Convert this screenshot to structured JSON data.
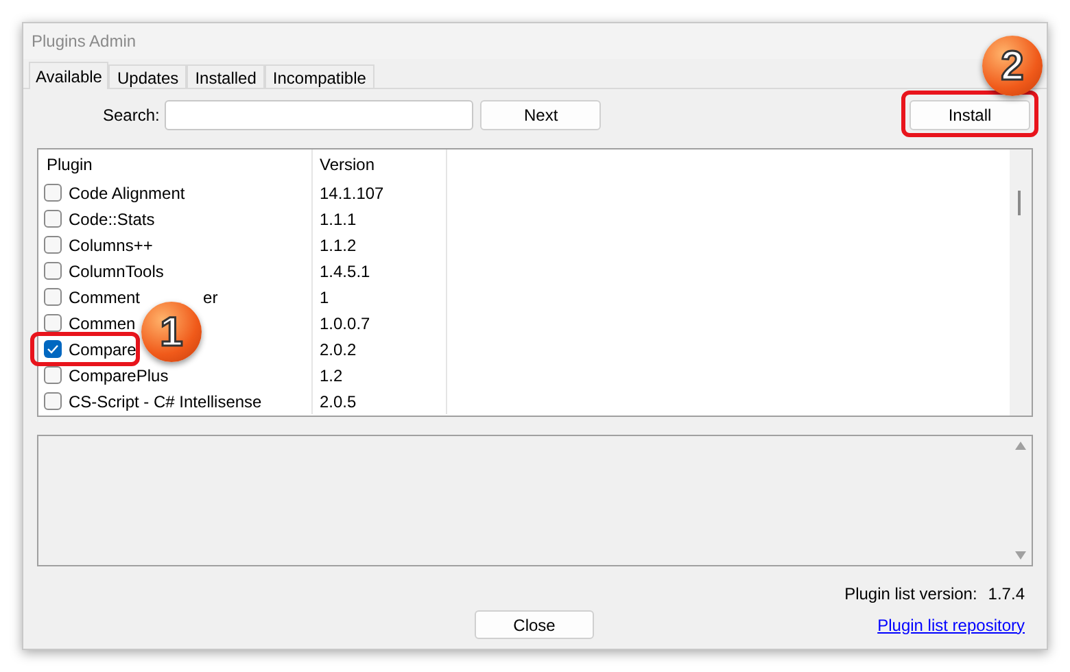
{
  "window": {
    "title": "Plugins Admin"
  },
  "tabs": [
    {
      "label": "Available",
      "selected": true
    },
    {
      "label": "Updates",
      "selected": false
    },
    {
      "label": "Installed",
      "selected": false
    },
    {
      "label": "Incompatible",
      "selected": false
    }
  ],
  "search": {
    "label": "Search:"
  },
  "buttons": {
    "next": "Next",
    "install": "Install",
    "close": "Close"
  },
  "table": {
    "columns": [
      "Plugin",
      "Version"
    ],
    "rows": [
      {
        "label": "Code Alignment",
        "version": "14.1.107",
        "checked": false
      },
      {
        "label": "Code::Stats",
        "version": "1.1.1",
        "checked": false
      },
      {
        "label": "Columns++",
        "version": "1.1.2",
        "checked": false
      },
      {
        "label": "ColumnTools",
        "version": "1.4.5.1",
        "checked": false
      },
      {
        "label": "Comment",
        "label_tail": "er",
        "version": "1",
        "checked": false
      },
      {
        "label": "Commen",
        "version": "1.0.0.7",
        "checked": false
      },
      {
        "label": "Compare",
        "version": "2.0.2",
        "checked": true,
        "highlighted": true
      },
      {
        "label": "ComparePlus",
        "version": "1.2",
        "checked": false
      },
      {
        "label": "CS-Script - C# Intellisense",
        "version": "2.0.5",
        "checked": false
      }
    ]
  },
  "footer": {
    "version_label": "Plugin list version:",
    "version": "1.7.4",
    "link": "Plugin list repository"
  },
  "callouts": [
    {
      "number": "1"
    },
    {
      "number": "2"
    }
  ]
}
